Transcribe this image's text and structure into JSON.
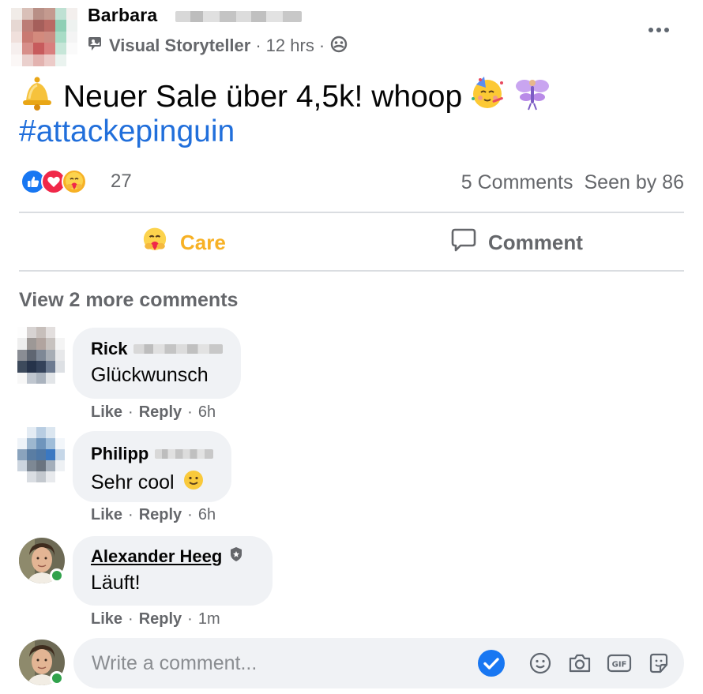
{
  "post": {
    "author_name": "Barbara",
    "author_role": "Visual Storyteller",
    "time": "12 hrs",
    "dot": "·",
    "text": "Neuer Sale über 4,5k! whoop",
    "hashtag": "#attackepinguin",
    "reaction_count": "27",
    "comments_count": "5 Comments",
    "seen_by": "Seen by 86",
    "icons": {
      "role_badge": "storyteller-icon",
      "audience": "group-icon",
      "bell": "bell-emoji",
      "party": "partying-face-emoji",
      "fairy": "fairy-emoji"
    }
  },
  "actions": {
    "care_label": "Care",
    "comment_label": "Comment"
  },
  "view_more": "View 2 more comments",
  "comments": [
    {
      "name": "Rick",
      "text": "Glückwunsch",
      "like": "Like",
      "reply": "Reply",
      "time": "6h"
    },
    {
      "name": "Philipp",
      "text": "Sehr cool",
      "like": "Like",
      "reply": "Reply",
      "time": "6h"
    },
    {
      "name": "Alexander Heeg",
      "text": "Läuft!",
      "like": "Like",
      "reply": "Reply",
      "time": "1m"
    }
  ],
  "meta_sep": "·",
  "composer": {
    "placeholder": "Write a comment..."
  },
  "colors": {
    "accent_blue": "#1877f2",
    "hashtag": "#216fdb",
    "care_yellow": "#f7b125",
    "muted": "#65676b",
    "online": "#31a24c"
  }
}
